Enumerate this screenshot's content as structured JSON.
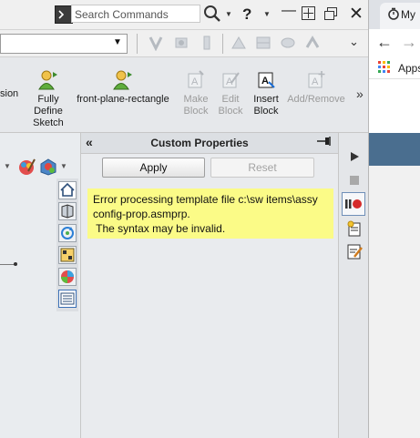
{
  "titlebar": {
    "search_placeholder": "Search Commands",
    "help_label": "?",
    "minimize_label": "—",
    "close_label": "✕"
  },
  "toolbar_row": {
    "combo_value": "",
    "more_label": "⌄"
  },
  "ribbon": {
    "cut_label": "sion",
    "buttons": [
      {
        "label": "Fully\nDefine\nSketch",
        "lines": [
          "Fully",
          "Define",
          "Sketch"
        ],
        "enabled": true
      },
      {
        "label": "front-plane-rectangle",
        "lines": [
          "front-plane-rectangle"
        ],
        "enabled": true
      },
      {
        "label": "Make Block",
        "lines": [
          "Make",
          "Block"
        ],
        "enabled": false
      },
      {
        "label": "Edit Block",
        "lines": [
          "Edit",
          "Block"
        ],
        "enabled": false
      },
      {
        "label": "Insert Block",
        "lines": [
          "Insert",
          "Block"
        ],
        "enabled": true
      },
      {
        "label": "Add/Remove",
        "lines": [
          "Add/Remove"
        ],
        "enabled": false
      }
    ],
    "more_label": "»"
  },
  "panel": {
    "title": "Custom Properties",
    "collapse_label": "«",
    "apply_label": "Apply",
    "reset_label": "Reset",
    "error_lines": [
      "Error processing template file c:\\sw items\\assy",
      "config-prop.asmprp.",
      " The syntax may be invalid."
    ]
  },
  "browser": {
    "tab_label": "My",
    "apps_label": "Apps"
  },
  "colors": {
    "error_bg": "#fbfb87",
    "panel_bg": "#e9ebee",
    "ribbon_bg": "#e6e8eb",
    "browser_banner": "#4a6e8f"
  },
  "icons": {
    "task_pane_tabs": [
      "home-icon",
      "part-library-icon",
      "refresh-icon",
      "view-palette-icon",
      "appearances-icon",
      "custom-properties-icon"
    ],
    "right_tools": [
      "play-icon",
      "stop-icon",
      "record-pause-icon",
      "sparkle-doc-icon",
      "edit-doc-icon"
    ]
  }
}
